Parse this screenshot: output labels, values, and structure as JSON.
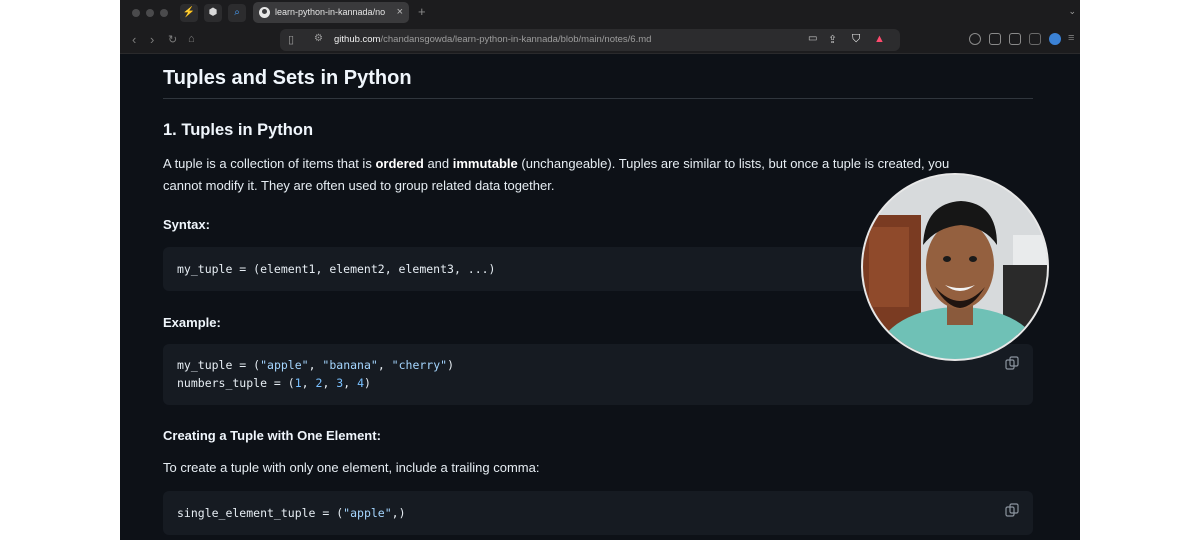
{
  "browser": {
    "tab_title": "learn-python-in-kannada/no",
    "tab_close": "×",
    "new_tab": "+",
    "url_host": "github.com",
    "url_path": "/chandansgowda/learn-python-in-kannada/blob/main/notes/6.md"
  },
  "article": {
    "title": "Tuples and Sets in Python",
    "section_heading": "1. Tuples in Python",
    "intro": {
      "pre_ordered": "A tuple is a collection of items that is ",
      "ordered": "ordered",
      "and": " and ",
      "immutable": "immutable",
      "line1_end": " (unchangeable). Tuples are similar to lists, but once a tuple is created, you",
      "line2": "cannot modify it. They are often used to group related data together."
    },
    "syntax_heading": "Syntax:",
    "syntax_code": "my_tuple = (element1, element2, element3, ...)",
    "example_heading": "Example:",
    "example_code": {
      "l1_a": "my_tuple = (",
      "l1_s1": "\"apple\"",
      "l1_c1": ", ",
      "l1_s2": "\"banana\"",
      "l1_c2": ", ",
      "l1_s3": "\"cherry\"",
      "l1_end": ")",
      "l2_a": "numbers_tuple = (",
      "l2_n1": "1",
      "l2_c1": ", ",
      "l2_n2": "2",
      "l2_c2": ", ",
      "l2_n3": "3",
      "l2_c3": ", ",
      "l2_n4": "4",
      "l2_end": ")"
    },
    "one_element_heading": "Creating a Tuple with One Element:",
    "one_element_text": "To create a tuple with only one element, include a trailing comma:",
    "one_element_code": {
      "a": "single_element_tuple = (",
      "s": "\"apple\"",
      "end": ",)"
    }
  }
}
